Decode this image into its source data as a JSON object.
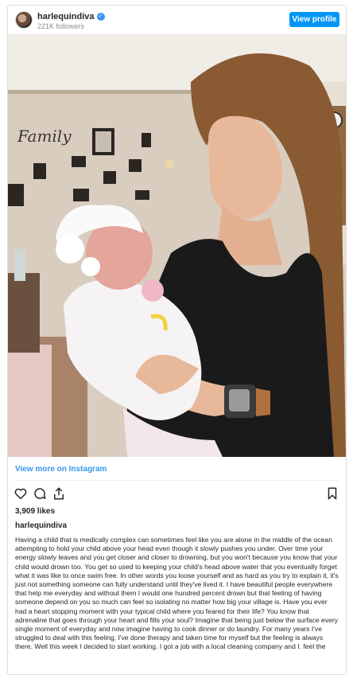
{
  "header": {
    "username": "harlequindiva",
    "followers": "221K followers",
    "view_profile": "View profile"
  },
  "photo": {
    "wall_text": "Family"
  },
  "post": {
    "view_more": "View more on Instagram",
    "likes": "3,909 likes",
    "caption_user": "harlequindiva",
    "caption": "Having a child that is medically complex can sometimes feel like you are alone in the middle of the ocean attempting to hold your child above your head even though it slowly pushes you under. Over time your energy slowly leaves and you get closer and closer to drowning, but you won't because you know that your child would drown too. You get so used to keeping your child's head above water that you eventually forget what it was like to once swim free. In other words you loose yourself and as hard as you try to explain it, it's just not something someone can fully understand until they've lived it. I have beautiful people everywhere that help me everyday and without them I would one hundred percent drown but that feeling of having someone depend on you so much can feel so isolating no matter how big your village is. Have you ever had a heart stopping moment with your typical child where you feared for their life? You know that adrenaline that goes through your heart and fills your soul? Imagine that being just below the surface every single moment of everyday and now imagine having to cook dinner or do laundry. For many years I've struggled to deal with this feeling, I've done therapy and taken time for myself but the feeling is always there. Well this week I decided to start working. I got a job with a local cleaning company and I. feel the"
  },
  "icons": {
    "like": "heart-icon",
    "comment": "comment-icon",
    "share": "share-icon",
    "save": "bookmark-icon",
    "verified": "verified-badge-icon"
  },
  "colors": {
    "accent": "#0095f6",
    "link": "#3897f0",
    "muted": "#8e8e8e"
  }
}
